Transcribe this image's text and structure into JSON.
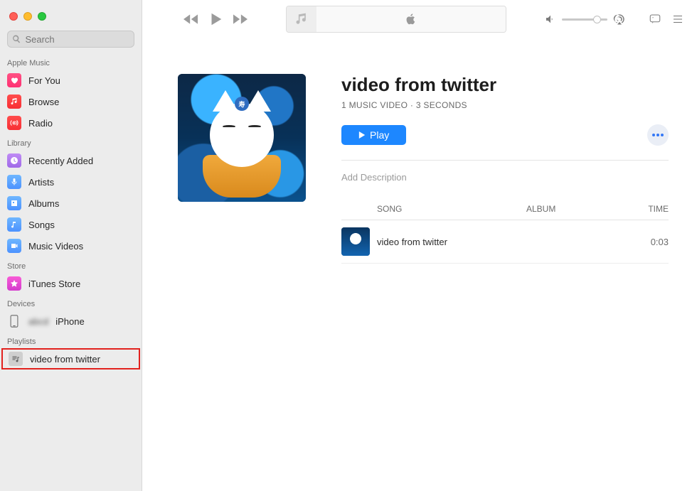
{
  "search": {
    "placeholder": "Search"
  },
  "sidebar": {
    "sections": [
      {
        "title": "Apple Music",
        "items": [
          {
            "label": "For You"
          },
          {
            "label": "Browse"
          },
          {
            "label": "Radio"
          }
        ]
      },
      {
        "title": "Library",
        "items": [
          {
            "label": "Recently Added"
          },
          {
            "label": "Artists"
          },
          {
            "label": "Albums"
          },
          {
            "label": "Songs"
          },
          {
            "label": "Music Videos"
          }
        ]
      },
      {
        "title": "Store",
        "items": [
          {
            "label": "iTunes Store"
          }
        ]
      },
      {
        "title": "Devices",
        "items": [
          {
            "label": "iPhone",
            "prefix_blurred": true
          }
        ]
      },
      {
        "title": "Playlists",
        "items": [
          {
            "label": "video from twitter",
            "highlighted": true
          }
        ]
      }
    ]
  },
  "playlist": {
    "title": "video from twitter",
    "subtitle": "1 MUSIC VIDEO · 3 SECONDS",
    "play_label": "Play",
    "description_placeholder": "Add Description",
    "columns": {
      "song": "SONG",
      "album": "ALBUM",
      "time": "TIME"
    },
    "tracks": [
      {
        "song": "video from twitter",
        "album": "",
        "time": "0:03"
      }
    ]
  }
}
